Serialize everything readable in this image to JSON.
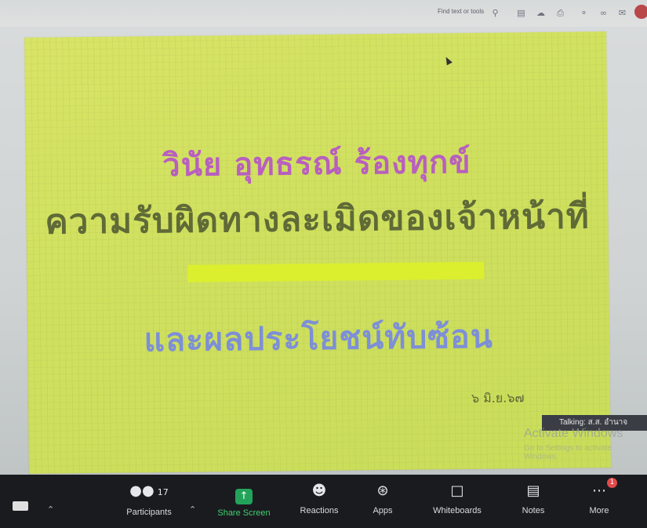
{
  "viewer": {
    "find_text": "Find text or tools",
    "icons": [
      "search-icon",
      "save-icon",
      "cloud-upload-icon",
      "print-icon",
      "read-aloud-icon",
      "link-icon",
      "mail-icon"
    ]
  },
  "slide": {
    "line1": "วินัย อุทธรณ์ ร้องทุกข์",
    "line2": "ความรับผิดทางละเมิดของเจ้าหน้าที่",
    "line3": "และผลประโยชน์ทับซ้อน",
    "date": "๖ มิ.ย.๖๗",
    "colors": {
      "background": "#cfe05e",
      "line1": "#b85fbf",
      "line2": "#5f6a37",
      "line3": "#7d8fd6",
      "highlight": "#dbef2e"
    }
  },
  "talking": "Talking: ส.ส. อำนาจ",
  "watermark": {
    "title": "Activate Windows",
    "subtitle": "Go to Settings to activate Windows."
  },
  "toolbar": {
    "participants_label": "Participants",
    "participants_count": "17",
    "share_label": "Share Screen",
    "reactions_label": "Reactions",
    "apps_label": "Apps",
    "whiteboards_label": "Whiteboards",
    "notes_label": "Notes",
    "more_label": "More",
    "more_badge": "1"
  }
}
